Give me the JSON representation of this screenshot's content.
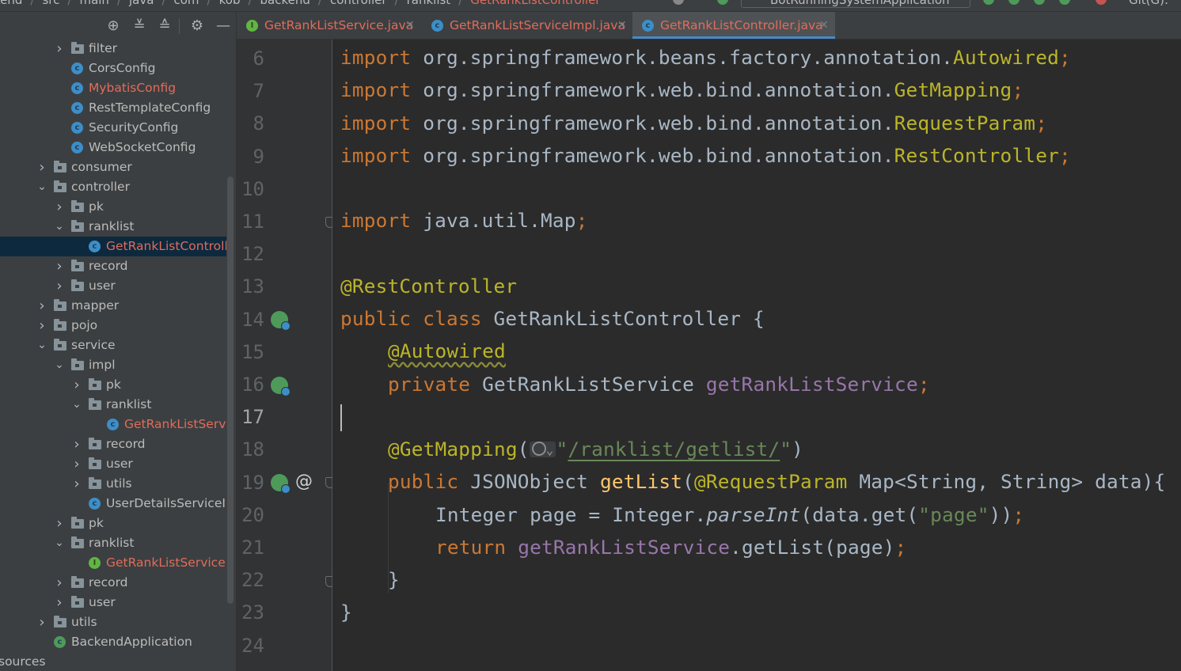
{
  "topbar": {
    "breadcrumbs": [
      "kend",
      "src",
      "main",
      "java",
      "com",
      "kob",
      "backend",
      "controller",
      "ranklist",
      "GetRankListController"
    ],
    "run_config": "BotRunningSystemApplication",
    "git_label": "Git(G):"
  },
  "project_tree": {
    "toolbar_icons": [
      "locate-icon",
      "expand-all-icon",
      "collapse-all-icon",
      "gear-icon",
      "hide-icon"
    ],
    "rows": [
      {
        "label": "filter",
        "type": "folder",
        "depth": 2,
        "expanded": false
      },
      {
        "label": "CorsConfig",
        "type": "class",
        "depth": 2
      },
      {
        "label": "MybatisConfig",
        "type": "class",
        "depth": 2,
        "error": true
      },
      {
        "label": "RestTemplateConfig",
        "type": "class",
        "depth": 2
      },
      {
        "label": "SecurityConfig",
        "type": "class",
        "depth": 2
      },
      {
        "label": "WebSocketConfig",
        "type": "class",
        "depth": 2
      },
      {
        "label": "consumer",
        "type": "folder",
        "depth": 1,
        "expanded": false
      },
      {
        "label": "controller",
        "type": "folder",
        "depth": 1,
        "expanded": true
      },
      {
        "label": "pk",
        "type": "folder",
        "depth": 2,
        "expanded": false
      },
      {
        "label": "ranklist",
        "type": "folder",
        "depth": 2,
        "expanded": true
      },
      {
        "label": "GetRankListController",
        "type": "class",
        "depth": 3,
        "error": true,
        "selected": true
      },
      {
        "label": "record",
        "type": "folder",
        "depth": 2,
        "expanded": false
      },
      {
        "label": "user",
        "type": "folder",
        "depth": 2,
        "expanded": false
      },
      {
        "label": "mapper",
        "type": "folder",
        "depth": 1,
        "expanded": false
      },
      {
        "label": "pojo",
        "type": "folder",
        "depth": 1,
        "expanded": false
      },
      {
        "label": "service",
        "type": "folder",
        "depth": 1,
        "expanded": true
      },
      {
        "label": "impl",
        "type": "folder",
        "depth": 2,
        "expanded": true
      },
      {
        "label": "pk",
        "type": "folder",
        "depth": 3,
        "expanded": false
      },
      {
        "label": "ranklist",
        "type": "folder",
        "depth": 3,
        "expanded": true
      },
      {
        "label": "GetRankListServiceImpl",
        "type": "class",
        "depth": 4,
        "error": true
      },
      {
        "label": "record",
        "type": "folder",
        "depth": 3,
        "expanded": false
      },
      {
        "label": "user",
        "type": "folder",
        "depth": 3,
        "expanded": false
      },
      {
        "label": "utils",
        "type": "folder",
        "depth": 3,
        "expanded": false
      },
      {
        "label": "UserDetailsServiceImpl",
        "type": "class",
        "depth": 3
      },
      {
        "label": "pk",
        "type": "folder",
        "depth": 2,
        "expanded": false
      },
      {
        "label": "ranklist",
        "type": "folder",
        "depth": 2,
        "expanded": true
      },
      {
        "label": "GetRankListService",
        "type": "interface",
        "depth": 3,
        "error": true
      },
      {
        "label": "record",
        "type": "folder",
        "depth": 2,
        "expanded": false
      },
      {
        "label": "user",
        "type": "folder",
        "depth": 2,
        "expanded": false
      },
      {
        "label": "utils",
        "type": "folder",
        "depth": 1,
        "expanded": false
      },
      {
        "label": "BackendApplication",
        "type": "spring",
        "depth": 1
      },
      {
        "label": "sources",
        "type": "plain",
        "depth": 0
      }
    ]
  },
  "tabs": [
    {
      "label": "GetRankListService.java",
      "kind": "interface",
      "active": false
    },
    {
      "label": "GetRankListServiceImpl.java",
      "kind": "class",
      "active": false
    },
    {
      "label": "GetRankListController.java",
      "kind": "class",
      "active": true
    }
  ],
  "editor": {
    "current_line": 17,
    "line_numbers": [
      "6",
      "7",
      "8",
      "9",
      "10",
      "11",
      "12",
      "13",
      "14",
      "15",
      "16",
      "17",
      "18",
      "19",
      "20",
      "21",
      "22",
      "23",
      "24"
    ],
    "code": {
      "l6_kw": "import",
      "l6_pkg": " org.springframework.beans.factory.annotation.",
      "l6_cls": "Autowired",
      "l6_end": ";",
      "l7_kw": "import",
      "l7_pkg": " org.springframework.web.bind.annotation.",
      "l7_cls": "GetMapping",
      "l7_end": ";",
      "l8_kw": "import",
      "l8_pkg": " org.springframework.web.bind.annotation.",
      "l8_cls": "RequestParam",
      "l8_end": ";",
      "l9_kw": "import",
      "l9_pkg": " org.springframework.web.bind.annotation.",
      "l9_cls": "RestController",
      "l9_end": ";",
      "l11_kw": "import",
      "l11_pkg": " java.util.Map",
      "l11_end": ";",
      "l13_ann": "@RestController",
      "l14_kw": "public class",
      "l14_name": " GetRankListController {",
      "l15_ann": "@Autowired",
      "l16_kw": "private",
      "l16_type": " GetRankListService ",
      "l16_fld": "getRankListService",
      "l16_end": ";",
      "l18_ann": "@GetMapping",
      "l18_open": "(",
      "l18_q1": "\"",
      "l18_str": "/ranklist/getlist/",
      "l18_q2": "\"",
      "l18_close": ")",
      "l19_kw": "public",
      "l19_type": " JSONObject ",
      "l19_method": "getList",
      "l19_open": "(",
      "l19_ann": "@RequestParam",
      "l19_rest": " Map<String, String> data){",
      "l20_type": "Integer page = Integer.",
      "l20_it": "parseInt",
      "l20_mid": "(data.get(",
      "l20_str": "\"page\"",
      "l20_close": "))",
      "l20_end": ";",
      "l21_kw": "return",
      "l21_fld": " getRankListService",
      "l21_rest": ".getList(page)",
      "l21_end": ";",
      "l22": "}",
      "l23": "}"
    }
  }
}
